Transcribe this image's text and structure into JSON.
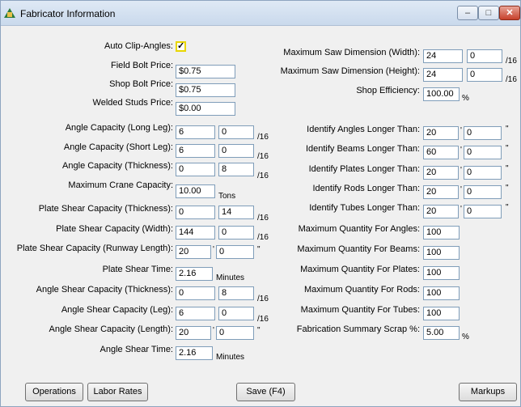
{
  "window": {
    "title": "Fabricator Information",
    "minimize_glyph": "–",
    "maximize_glyph": "□",
    "close_glyph": "✕"
  },
  "left": {
    "auto_clip": {
      "label": "Auto Clip-Angles:",
      "checked": true
    },
    "field_bolt_price": {
      "label": "Field Bolt Price:",
      "value": "$0.75"
    },
    "shop_bolt_price": {
      "label": "Shop Bolt Price:",
      "value": "$0.75"
    },
    "welded_studs_price": {
      "label": "Welded Studs Price:",
      "value": "$0.00"
    },
    "angle_long_leg": {
      "label": "Angle Capacity (Long Leg):",
      "v1": "6",
      "v2": "0",
      "unit": "/16"
    },
    "angle_short_leg": {
      "label": "Angle Capacity (Short Leg):",
      "v1": "6",
      "v2": "0",
      "unit": "/16"
    },
    "angle_thickness": {
      "label": "Angle Capacity (Thickness):",
      "v1": "0",
      "v2": "8",
      "unit": "/16"
    },
    "crane_capacity": {
      "label": "Maximum Crane Capacity:",
      "value": "10.00",
      "unit": "Tons"
    },
    "plate_thickness": {
      "label": "Plate Shear Capacity (Thickness):",
      "v1": "0",
      "v2": "14",
      "unit": "/16"
    },
    "plate_width": {
      "label": "Plate Shear Capacity (Width):",
      "v1": "144",
      "v2": "0",
      "unit": "/16"
    },
    "plate_runway": {
      "label": "Plate Shear Capacity (Runway Length):",
      "v1": "20",
      "v2": "0",
      "foot": "'",
      "inch": "\""
    },
    "plate_time": {
      "label": "Plate Shear Time:",
      "value": "2.16",
      "unit": "Minutes"
    },
    "angle_shear_thickness": {
      "label": "Angle Shear Capacity (Thickness):",
      "v1": "0",
      "v2": "8",
      "unit": "/16"
    },
    "angle_shear_leg": {
      "label": "Angle Shear Capacity (Leg):",
      "v1": "6",
      "v2": "0",
      "unit": "/16"
    },
    "angle_shear_length": {
      "label": "Angle Shear Capacity (Length):",
      "v1": "20",
      "v2": "0",
      "foot": "'",
      "inch": "\""
    },
    "angle_shear_time": {
      "label": "Angle Shear Time:",
      "value": "2.16",
      "unit": "Minutes"
    }
  },
  "right": {
    "saw_width": {
      "label": "Maximum Saw Dimension (Width):",
      "v1": "24",
      "v2": "0",
      "unit": "/16"
    },
    "saw_height": {
      "label": "Maximum Saw Dimension (Height):",
      "v1": "24",
      "v2": "0",
      "unit": "/16"
    },
    "shop_efficiency": {
      "label": "Shop Efficiency:",
      "value": "100.00",
      "unit": "%"
    },
    "id_angles": {
      "label": "Identify Angles Longer Than:",
      "v1": "20",
      "v2": "0",
      "foot": "'",
      "inch": "\""
    },
    "id_beams": {
      "label": "Identify Beams Longer Than:",
      "v1": "60",
      "v2": "0",
      "foot": "'",
      "inch": "\""
    },
    "id_plates": {
      "label": "Identify Plates Longer Than:",
      "v1": "20",
      "v2": "0",
      "foot": "'",
      "inch": "\""
    },
    "id_rods": {
      "label": "Identify Rods Longer Than:",
      "v1": "20",
      "v2": "0",
      "foot": "'",
      "inch": "\""
    },
    "id_tubes": {
      "label": "Identify Tubes Longer Than:",
      "v1": "20",
      "v2": "0",
      "foot": "'",
      "inch": "\""
    },
    "max_angles": {
      "label": "Maximum Quantity For Angles:",
      "value": "100"
    },
    "max_beams": {
      "label": "Maximum Quantity For Beams:",
      "value": "100"
    },
    "max_plates": {
      "label": "Maximum Quantity For Plates:",
      "value": "100"
    },
    "max_rods": {
      "label": "Maximum Quantity For Rods:",
      "value": "100"
    },
    "max_tubes": {
      "label": "Maximum Quantity For Tubes:",
      "value": "100"
    },
    "scrap": {
      "label": "Fabrication Summary Scrap %:",
      "value": "5.00",
      "unit": "%"
    }
  },
  "buttons": {
    "operations": "Operations",
    "labor_rates": "Labor Rates",
    "save": "Save (F4)",
    "markups": "Markups"
  }
}
